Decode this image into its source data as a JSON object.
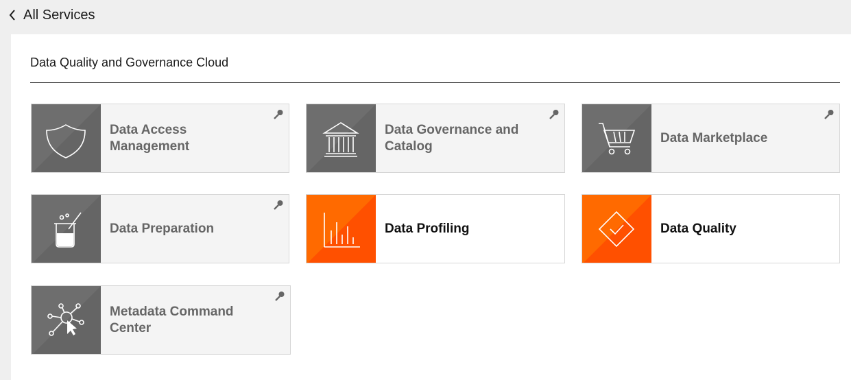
{
  "header": {
    "back_label": "All Services"
  },
  "section": {
    "title": "Data Quality and Governance Cloud"
  },
  "tiles": [
    {
      "label": "Data Access Management",
      "icon": "shield-icon",
      "enabled": false,
      "licensed": false
    },
    {
      "label": "Data Governance and Catalog",
      "icon": "building-icon",
      "enabled": false,
      "licensed": false
    },
    {
      "label": "Data Marketplace",
      "icon": "cart-icon",
      "enabled": false,
      "licensed": false
    },
    {
      "label": "Data Preparation",
      "icon": "beaker-icon",
      "enabled": false,
      "licensed": false
    },
    {
      "label": "Data Profiling",
      "icon": "bar-chart-icon",
      "enabled": true,
      "licensed": true
    },
    {
      "label": "Data Quality",
      "icon": "diamond-check-icon",
      "enabled": true,
      "licensed": true
    },
    {
      "label": "Metadata Command Center",
      "icon": "network-pointer-icon",
      "enabled": false,
      "licensed": false
    }
  ],
  "colors": {
    "disabled": "#6e6e6e",
    "enabled": "#ff5a00",
    "page_bg": "#efefef"
  }
}
